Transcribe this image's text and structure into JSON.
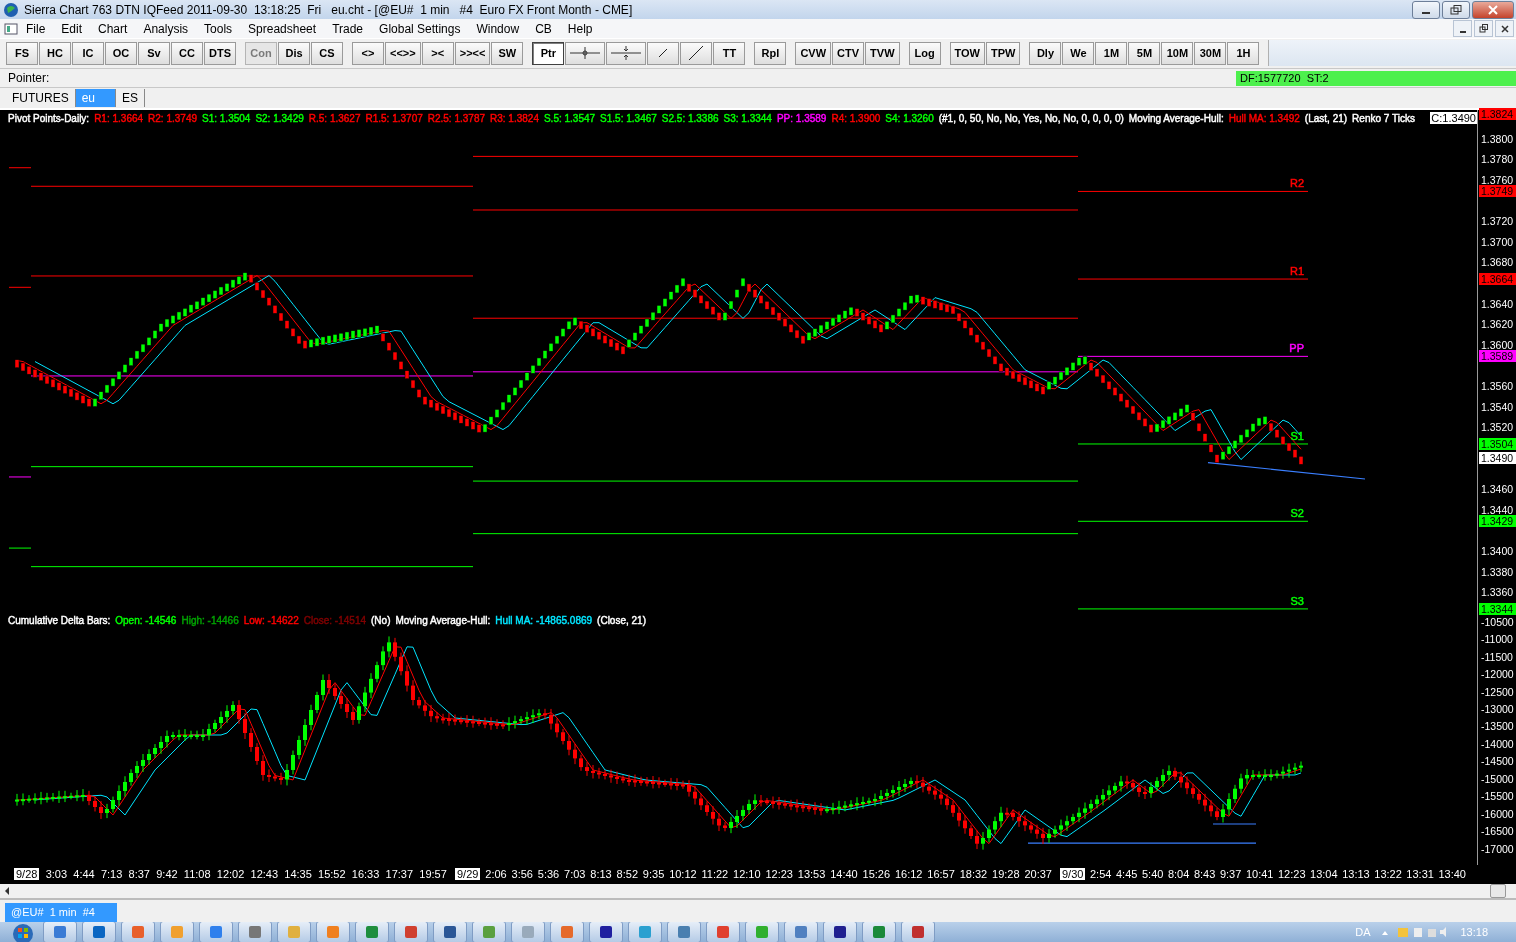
{
  "window": {
    "title": "Sierra Chart 763 DTN IQFeed 2011-09-30  13:18:25  Fri   eu.cht - [@EU#  1 min   #4  Euro FX Front Month - CME]"
  },
  "menu": [
    "File",
    "Edit",
    "Chart",
    "Analysis",
    "Tools",
    "Spreadsheet",
    "Trade",
    "Global Settings",
    "Window",
    "CB",
    "Help"
  ],
  "toolbar": [
    [
      {
        "kind": "text",
        "label": "FS",
        "selected": false,
        "disabled": false
      },
      {
        "kind": "text",
        "label": "HC",
        "selected": false,
        "disabled": false
      },
      {
        "kind": "text",
        "label": "IC",
        "selected": false,
        "disabled": false
      },
      {
        "kind": "text",
        "label": "OC",
        "selected": false,
        "disabled": false
      },
      {
        "kind": "text",
        "label": "Sv",
        "selected": false,
        "disabled": false
      },
      {
        "kind": "text",
        "label": "CC",
        "selected": false,
        "disabled": false
      },
      {
        "kind": "text",
        "label": "DTS",
        "selected": false,
        "disabled": false
      }
    ],
    [
      {
        "kind": "text",
        "label": "Con",
        "selected": false,
        "disabled": true
      },
      {
        "kind": "text",
        "label": "Dis",
        "selected": false,
        "disabled": false
      },
      {
        "kind": "text",
        "label": "CS",
        "selected": false,
        "disabled": false
      }
    ],
    [
      {
        "kind": "text",
        "label": "<>",
        "selected": false,
        "disabled": false
      },
      {
        "kind": "text",
        "label": "<<>>",
        "selected": false,
        "disabled": false
      },
      {
        "kind": "text",
        "label": "><",
        "selected": false,
        "disabled": false
      },
      {
        "kind": "text",
        "label": ">><<",
        "selected": false,
        "disabled": false
      },
      {
        "kind": "text",
        "label": "SW",
        "selected": false,
        "disabled": false
      }
    ],
    [
      {
        "kind": "text",
        "label": "Ptr",
        "selected": true,
        "disabled": false
      },
      {
        "kind": "crosshair",
        "selected": false,
        "disabled": false
      },
      {
        "kind": "splitcross",
        "selected": false,
        "disabled": false
      },
      {
        "kind": "shortline",
        "selected": false,
        "disabled": false
      },
      {
        "kind": "longline",
        "selected": false,
        "disabled": false
      },
      {
        "kind": "text",
        "label": "TT",
        "selected": false,
        "disabled": false
      }
    ],
    [
      {
        "kind": "text",
        "label": "Rpl",
        "selected": false,
        "disabled": false
      }
    ],
    [
      {
        "kind": "text",
        "label": "CVW",
        "selected": false,
        "disabled": false
      },
      {
        "kind": "text",
        "label": "CTV",
        "selected": false,
        "disabled": false
      },
      {
        "kind": "text",
        "label": "TVW",
        "selected": false,
        "disabled": false
      }
    ],
    [
      {
        "kind": "text",
        "label": "Log",
        "selected": false,
        "disabled": false
      }
    ],
    [
      {
        "kind": "text",
        "label": "TOW",
        "selected": false,
        "disabled": false
      },
      {
        "kind": "text",
        "label": "TPW",
        "selected": false,
        "disabled": false
      }
    ],
    [
      {
        "kind": "text",
        "label": "Dly",
        "selected": false,
        "disabled": false
      },
      {
        "kind": "text",
        "label": "We",
        "selected": false,
        "disabled": false
      },
      {
        "kind": "text",
        "label": "1M",
        "selected": false,
        "disabled": false
      },
      {
        "kind": "text",
        "label": "5M",
        "selected": false,
        "disabled": false
      },
      {
        "kind": "text",
        "label": "10M",
        "selected": false,
        "disabled": false
      },
      {
        "kind": "text",
        "label": "30M",
        "selected": false,
        "disabled": false
      },
      {
        "kind": "text",
        "label": "1H",
        "selected": false,
        "disabled": false
      }
    ]
  ],
  "pointer": {
    "label": "Pointer:",
    "status": "DF:1577720  ST:2"
  },
  "chart_tabs": [
    {
      "label": "FUTURES",
      "selected": false
    },
    {
      "label": "eu",
      "selected": true
    },
    {
      "label": "ES",
      "selected": false
    }
  ],
  "price_panel": {
    "kind": "renko",
    "header": [
      {
        "text": "Pivot Points-Daily:",
        "color": "#ffffff"
      },
      {
        "text": "R1: 1.3664",
        "color": "#ff0000"
      },
      {
        "text": "R2: 1.3749",
        "color": "#ff0000"
      },
      {
        "text": "S1: 1.3504",
        "color": "#00ff00"
      },
      {
        "text": "S2: 1.3429",
        "color": "#00ff00"
      },
      {
        "text": "R.5: 1.3627",
        "color": "#ff0000"
      },
      {
        "text": "R1.5: 1.3707",
        "color": "#ff0000"
      },
      {
        "text": "R2.5: 1.3787",
        "color": "#ff0000"
      },
      {
        "text": "R3: 1.3824",
        "color": "#ff0000"
      },
      {
        "text": "S.5: 1.3547",
        "color": "#00ff00"
      },
      {
        "text": "S1.5: 1.3467",
        "color": "#00ff00"
      },
      {
        "text": "S2.5: 1.3386",
        "color": "#00ff00"
      },
      {
        "text": "S3: 1.3344",
        "color": "#00ff00"
      },
      {
        "text": "PP: 1.3589",
        "color": "#ff00ff"
      },
      {
        "text": "R4: 1.3900",
        "color": "#ff0000"
      },
      {
        "text": "S4: 1.3260",
        "color": "#00ff00"
      },
      {
        "text": "(#1, 0, 50, No, No, Yes, No, No, 0, 0, 0, 0)",
        "color": "#ffffff"
      },
      {
        "text": "Moving Average-Hull:",
        "color": "#ffffff"
      },
      {
        "text": "Hull MA: 1.3492",
        "color": "#ff0000"
      },
      {
        "text": "(Last, 21)",
        "color": "#ffffff"
      },
      {
        "text": "Renko 7 Ticks",
        "color": "#ffffff"
      }
    ],
    "last_price": "C:1.3490",
    "axis_labels": [
      "1.3800",
      "1.3780",
      "1.3760",
      "1.3720",
      "1.3700",
      "1.3680",
      "1.3640",
      "1.3620",
      "1.3600",
      "1.3560",
      "1.3540",
      "1.3520",
      "1.3460",
      "1.3440",
      "1.3400",
      "1.3380",
      "1.3360"
    ],
    "markers": [
      {
        "label": "1.3824",
        "color": "#ff0000"
      },
      {
        "label": "1.3749",
        "color": "#ff0000"
      },
      {
        "label": "1.3664",
        "color": "#ff0000"
      },
      {
        "label": "1.3589",
        "color": "#ff00ff"
      },
      {
        "label": "1.3504",
        "color": "#00ff00"
      },
      {
        "label": "1.3490",
        "color": "#ffffff"
      },
      {
        "label": "1.3429",
        "color": "#00ff00"
      },
      {
        "label": "1.3344",
        "color": "#00ff00"
      }
    ],
    "pivot_labels": [
      {
        "label": "R2",
        "color": "#ff0000"
      },
      {
        "label": "R1",
        "color": "#ff0000"
      },
      {
        "label": "PP",
        "color": "#ff00ff"
      },
      {
        "label": "S1",
        "color": "#00ff00"
      },
      {
        "label": "S2",
        "color": "#00ff00"
      },
      {
        "label": "S3",
        "color": "#00ff00"
      }
    ]
  },
  "delta_panel": {
    "kind": "candles",
    "header": [
      {
        "text": "Cumulative Delta Bars:",
        "color": "#ffffff"
      },
      {
        "text": "Open: -14546",
        "color": "#00ff00"
      },
      {
        "text": "High: -14466",
        "color": "#00a000"
      },
      {
        "text": "Low: -14622",
        "color": "#ff0000"
      },
      {
        "text": "Close: -14514",
        "color": "#800000"
      },
      {
        "text": "(No)",
        "color": "#ffffff"
      },
      {
        "text": "Moving Average-Hull:",
        "color": "#ffffff"
      },
      {
        "text": "Hull MA: -14865.0869",
        "color": "#00e5ff"
      },
      {
        "text": "(Close, 21)",
        "color": "#ffffff"
      }
    ],
    "axis_labels": [
      "-10500",
      "-11000",
      "-11500",
      "-12000",
      "-12500",
      "-13000",
      "-13500",
      "-14000",
      "-14500",
      "-15000",
      "-15500",
      "-16000",
      "-16500",
      "-17000"
    ]
  },
  "time_axis": [
    {
      "date": "9/28",
      "times": [
        "3:03",
        "4:44",
        "7:13",
        "8:37",
        "9:42",
        "11:08",
        "12:02",
        "12:43",
        "14:35",
        "15:52",
        "16:33",
        "17:37",
        "19:57"
      ]
    },
    {
      "date": "9/29",
      "times": [
        "2:06",
        "3:56",
        "5:36",
        "7:03",
        "8:13",
        "8:52",
        "9:35",
        "10:12",
        "11:22",
        "12:10",
        "12:23",
        "13:53",
        "14:40",
        "15:26",
        "16:12",
        "16:57",
        "18:32",
        "19:28",
        "20:37"
      ]
    },
    {
      "date": "9/30",
      "times": [
        "2:54",
        "4:45",
        "5:40",
        "8:04",
        "8:43",
        "9:37",
        "10:41",
        "12:23",
        "13:04",
        "13:13",
        "13:22",
        "13:31",
        "13:40"
      ]
    }
  ],
  "sheet_tabs": [
    {
      "label": "@EU#  1 min  #4",
      "selected": true
    }
  ],
  "taskbar": {
    "language": "DA",
    "clock": "13:18"
  }
}
